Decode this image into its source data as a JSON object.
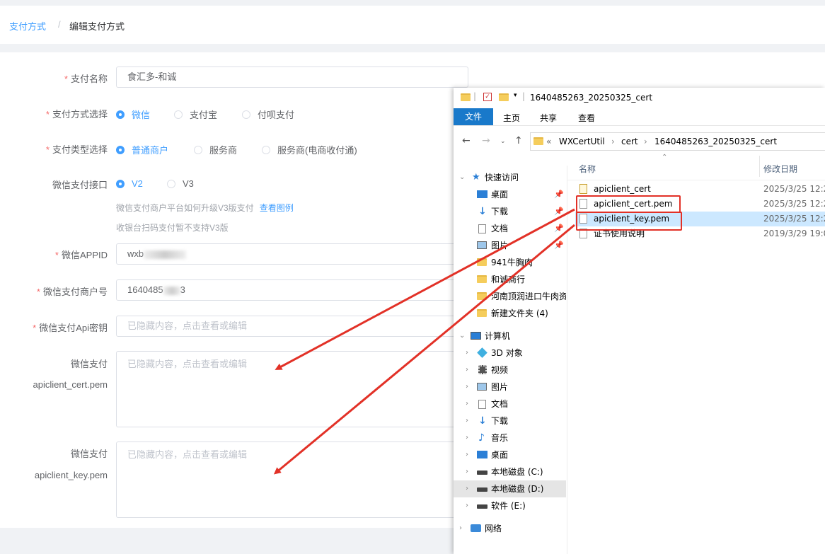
{
  "breadcrumb": {
    "parent": "支付方式",
    "separator": "/",
    "current": "编辑支付方式"
  },
  "form": {
    "pay_name": {
      "label": "支付名称",
      "value": "食汇多-和诚"
    },
    "pay_method": {
      "label": "支付方式选择",
      "options": [
        "微信",
        "支付宝",
        "付呗支付"
      ],
      "selected": "微信"
    },
    "pay_type": {
      "label": "支付类型选择",
      "options": [
        "普通商户",
        "服务商",
        "服务商(电商收付通)"
      ],
      "selected": "普通商户"
    },
    "wx_api": {
      "label": "微信支付接口",
      "options": [
        "V2",
        "V3"
      ],
      "selected": "V2",
      "help1": "微信支付商户平台如何升级V3版支付",
      "help_link": "查看图例",
      "help2": "收银台扫码支付暂不支持V3版"
    },
    "appid": {
      "label": "微信APPID",
      "value_prefix": "wxb"
    },
    "mch_id": {
      "label": "微信支付商户号",
      "value_prefix": "1640485",
      "value_suffix": "3"
    },
    "api_key": {
      "label": "微信支付Api密钥",
      "placeholder": "已隐藏内容，点击查看或编辑"
    },
    "cert": {
      "label1": "微信支付",
      "label2": "apiclient_cert.pem",
      "placeholder": "已隐藏内容，点击查看或编辑"
    },
    "key": {
      "label1": "微信支付",
      "label2": "apiclient_key.pem",
      "placeholder": "已隐藏内容，点击查看或编辑"
    }
  },
  "explorer": {
    "title": "1640485263_20250325_cert",
    "ribbon_tabs": [
      "文件",
      "主页",
      "共享",
      "查看"
    ],
    "address": {
      "prefix": "«",
      "parts": [
        "WXCertUtil",
        "cert",
        "1640485263_20250325_cert"
      ],
      "sep": "›"
    },
    "tree": [
      {
        "label": "快速访问",
        "icon": "star-icon"
      },
      {
        "label": "桌面",
        "icon": "desktop-icon"
      },
      {
        "label": "下载",
        "icon": "download-icon"
      },
      {
        "label": "文档",
        "icon": "document-icon"
      },
      {
        "label": "图片",
        "icon": "picture-icon"
      },
      {
        "label": "941牛胸肉",
        "icon": "folder-icon"
      },
      {
        "label": "和诚商行",
        "icon": "folder-icon"
      },
      {
        "label": "河南顶润进口牛肉资",
        "icon": "folder-icon"
      },
      {
        "label": "新建文件夹 (4)",
        "icon": "folder-icon"
      },
      {
        "label": "计算机",
        "icon": "computer-icon"
      },
      {
        "label": "3D 对象",
        "icon": "3d-objects-icon"
      },
      {
        "label": "视频",
        "icon": "video-icon"
      },
      {
        "label": "图片",
        "icon": "picture-icon"
      },
      {
        "label": "文档",
        "icon": "document-icon"
      },
      {
        "label": "下载",
        "icon": "download-icon"
      },
      {
        "label": "音乐",
        "icon": "music-icon"
      },
      {
        "label": "桌面",
        "icon": "desktop-icon"
      },
      {
        "label": "本地磁盘 (C:)",
        "icon": "drive-icon"
      },
      {
        "label": "本地磁盘 (D:)",
        "icon": "drive-icon"
      },
      {
        "label": "软件 (E:)",
        "icon": "drive-icon"
      },
      {
        "label": "网络",
        "icon": "network-icon"
      }
    ],
    "columns": {
      "name": "名称",
      "date": "修改日期"
    },
    "files": [
      {
        "name": "apiclient_cert",
        "date": "2025/3/25 12:2"
      },
      {
        "name": "apiclient_cert.pem",
        "date": "2025/3/25 12:2"
      },
      {
        "name": "apiclient_key.pem",
        "date": "2025/3/25 12:2"
      },
      {
        "name": "证书使用说明",
        "date": "2019/3/29 19:0"
      }
    ]
  },
  "colors": {
    "accent": "#409eff",
    "required": "#f56c6c",
    "annotation": "#e23127",
    "ribbon_file": "#1979ca"
  }
}
